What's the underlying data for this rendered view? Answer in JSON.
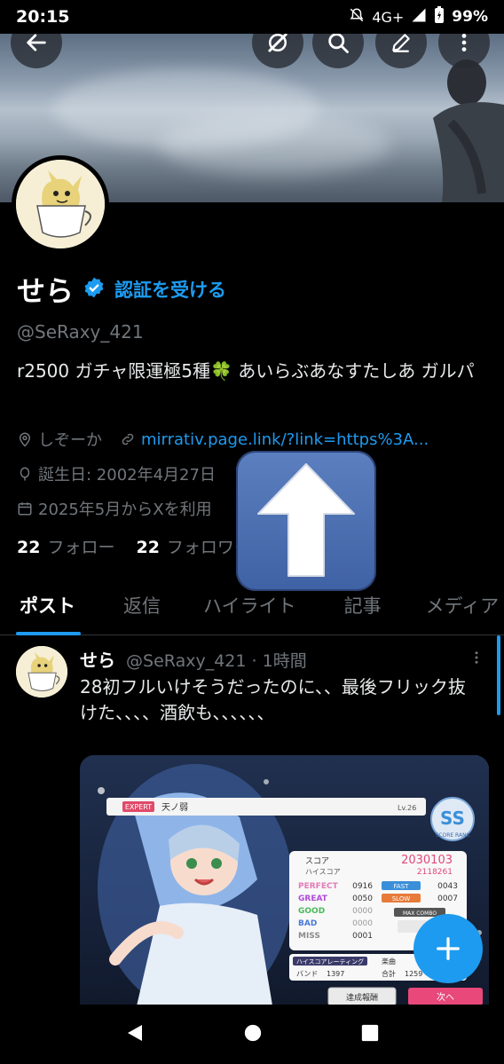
{
  "status_bar": {
    "time": "20:15",
    "network": "4G+",
    "battery": "99%"
  },
  "profile": {
    "name": "せら",
    "verify_link": "認証を受ける",
    "handle": "@SeRaxy_421",
    "bio": "r2500 ガチャ限運極5種🍀 あいらぶあなすたしあ ガルパ",
    "location": "しぞーか",
    "website": "mirrativ.page.link/?link=https%3A...",
    "birthday": "誕生日: 2002年4月27日",
    "joined": "2025年5月からXを利用"
  },
  "follow": {
    "following_count": "22",
    "following_label": "フォロー",
    "followers_count": "22",
    "followers_label": "フォロワー"
  },
  "tabs": [
    {
      "label": "ポスト"
    },
    {
      "label": "返信"
    },
    {
      "label": "ハイライト"
    },
    {
      "label": "記事"
    },
    {
      "label": "メディア"
    }
  ],
  "post": {
    "name": "せら",
    "handle": "@SeRaxy_421",
    "time": "· 1時間",
    "text": "28初フルいけそうだったのに、、最後フリック抜けた、、、、酒飲も、、、、、、"
  },
  "media": {
    "difficulty": "EXPERT",
    "song": "天ノ弱",
    "level": "Lv.26",
    "score_label": "スコア",
    "score": "2030103",
    "hiscore_label": "ハイスコア",
    "hiscore": "2118261",
    "perfect_label": "PERFECT",
    "perfect": "0916",
    "great_label": "GREAT",
    "great": "0050",
    "good_label": "GOOD",
    "good": "0000",
    "bad_label": "BAD",
    "bad": "0000",
    "miss_label": "MISS",
    "miss": "0001",
    "fast_label": "FAST",
    "fast": "0043",
    "slow_label": "SLOW",
    "slow": "0007",
    "maxcombo_label": "MAX COMBO",
    "rank": "SS",
    "rank_label": "SCORE RANK",
    "rating_label": "ハイスコアレーティング",
    "band_label": "バンド",
    "band_value": "1397",
    "music_label": "楽曲",
    "total_label": "合計",
    "total_value": "1259",
    "achieve_label": "達成報酬",
    "next_label": "次へ"
  },
  "colors": {
    "accent": "#1d9bf0",
    "background": "#000000",
    "muted": "#71767b"
  }
}
